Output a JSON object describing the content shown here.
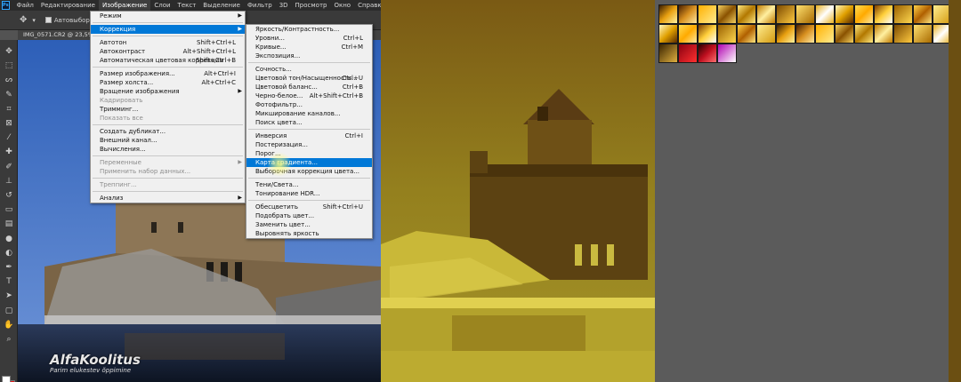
{
  "menubar": {
    "items": [
      "Файл",
      "Редактирование",
      "Изображение",
      "Слои",
      "Текст",
      "Выделение",
      "Фильтр",
      "3D",
      "Просмотр",
      "Окно",
      "Справка"
    ],
    "active_index": 2
  },
  "options_bar": {
    "autoselect_label": "Автовыбор:"
  },
  "document": {
    "tab_title": "IMG_0571.CR2 @ 23,5% (R..."
  },
  "image_menu": [
    {
      "label": "Режим",
      "arrow": true
    },
    {
      "sep": true
    },
    {
      "label": "Коррекция",
      "arrow": true,
      "highlight": true
    },
    {
      "sep": true
    },
    {
      "label": "Автотон",
      "shortcut": "Shift+Ctrl+L"
    },
    {
      "label": "Автоконтраст",
      "shortcut": "Alt+Shift+Ctrl+L"
    },
    {
      "label": "Автоматическая цветовая коррекция",
      "shortcut": "Shift+Ctrl+B"
    },
    {
      "sep": true
    },
    {
      "label": "Размер изображения...",
      "shortcut": "Alt+Ctrl+I"
    },
    {
      "label": "Размер холста...",
      "shortcut": "Alt+Ctrl+C"
    },
    {
      "label": "Вращение изображения",
      "arrow": true
    },
    {
      "label": "Кадрировать",
      "disabled": true
    },
    {
      "label": "Тримминг..."
    },
    {
      "label": "Показать все",
      "disabled": true
    },
    {
      "sep": true
    },
    {
      "label": "Создать дубликат..."
    },
    {
      "label": "Внешний канал..."
    },
    {
      "label": "Вычисления..."
    },
    {
      "sep": true
    },
    {
      "label": "Переменные",
      "arrow": true,
      "disabled": true
    },
    {
      "label": "Применить набор данных...",
      "disabled": true
    },
    {
      "sep": true
    },
    {
      "label": "Треппинг...",
      "disabled": true
    },
    {
      "sep": true
    },
    {
      "label": "Анализ",
      "arrow": true
    }
  ],
  "adjust_menu": [
    {
      "label": "Яркость/Контрастность..."
    },
    {
      "label": "Уровни...",
      "shortcut": "Ctrl+L"
    },
    {
      "label": "Кривые...",
      "shortcut": "Ctrl+M"
    },
    {
      "label": "Экспозиция..."
    },
    {
      "sep": true
    },
    {
      "label": "Сочность..."
    },
    {
      "label": "Цветовой тон/Насыщенность...",
      "shortcut": "Ctrl+U"
    },
    {
      "label": "Цветовой баланс...",
      "shortcut": "Ctrl+B"
    },
    {
      "label": "Черно-белое...",
      "shortcut": "Alt+Shift+Ctrl+B"
    },
    {
      "label": "Фотофильтр..."
    },
    {
      "label": "Микширование каналов..."
    },
    {
      "label": "Поиск цвета..."
    },
    {
      "sep": true
    },
    {
      "label": "Инверсия",
      "shortcut": "Ctrl+I"
    },
    {
      "label": "Постеризация..."
    },
    {
      "label": "Порог..."
    },
    {
      "label": "Карта градиента...",
      "highlight": true
    },
    {
      "label": "Выборочная коррекция цвета..."
    },
    {
      "sep": true
    },
    {
      "label": "Тени/Света..."
    },
    {
      "label": "Тонирование HDR..."
    },
    {
      "sep": true
    },
    {
      "label": "Обесцветить",
      "shortcut": "Shift+Ctrl+U"
    },
    {
      "label": "Подобрать цвет..."
    },
    {
      "label": "Заменить цвет..."
    },
    {
      "label": "Выровнять яркость"
    }
  ],
  "watermark": {
    "title": "AlfaKoolitus",
    "subtitle": "Parim elukestev õppimine"
  },
  "colors": {
    "menu_highlight": "#0078d7",
    "foreground_swatch": "#ffffff",
    "background_swatch": "#e01818",
    "duotone_dark": "#6b4a10",
    "duotone_light": "#d4c432"
  },
  "tool_icons": [
    "move-icon",
    "marquee-icon",
    "lasso-icon",
    "quick-select-icon",
    "crop-icon",
    "frame-icon",
    "eyedropper-icon",
    "healing-icon",
    "brush-icon",
    "stamp-icon",
    "history-brush-icon",
    "eraser-icon",
    "gradient-icon",
    "blur-icon",
    "dodge-icon",
    "pen-icon",
    "type-icon",
    "path-select-icon",
    "shape-icon",
    "hand-icon",
    "zoom-icon"
  ]
}
